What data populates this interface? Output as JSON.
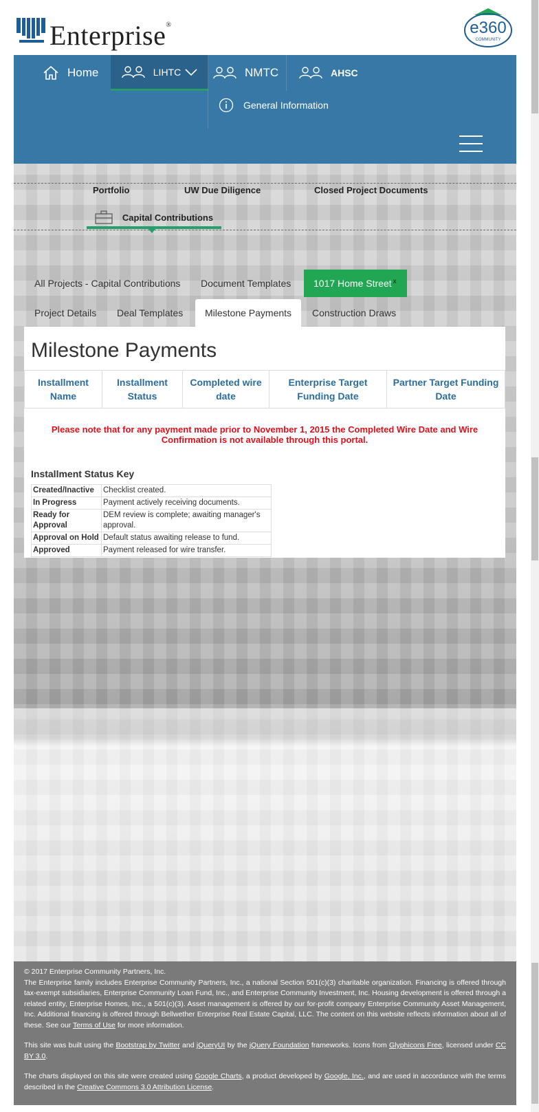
{
  "brand": {
    "name": "Enterprise",
    "reg": "®",
    "badge": "e360",
    "badge_sub": "COMMUNITY"
  },
  "nav": {
    "home": "Home",
    "lihtc": "LIHTC",
    "nmtc": "NMTC",
    "ahsc": "AHSC",
    "general_info": "General Information"
  },
  "subnav": {
    "portfolio": "Portfolio",
    "uw_due_diligence": "UW Due Diligence",
    "closed_docs": "Closed Project Documents",
    "capital_contributions": "Capital Contributions"
  },
  "tabs_row1": [
    "All Projects - Capital Contributions",
    "Document Templates",
    "1017 Home Street"
  ],
  "tab_close": "x",
  "tabs_row2": [
    "Project Details",
    "Deal Templates",
    "Milestone Payments",
    "Construction Draws"
  ],
  "main": {
    "title": "Milestone Payments",
    "columns": [
      "Installment Name",
      "Installment Status",
      "Completed wire date",
      "Enterprise Target Funding Date",
      "Partner Target Funding Date"
    ],
    "note": "Please note that for any payment made prior to November 1, 2015 the Completed Wire Date and Wire Confirmation is not available through this portal.",
    "key_title": "Installment Status Key",
    "key_rows": [
      {
        "status": "Created/Inactive",
        "desc": "Checklist created."
      },
      {
        "status": "In Progress",
        "desc": "Payment actively receiving documents."
      },
      {
        "status": "Ready for Approval",
        "desc": "DEM review is complete; awaiting manager's approval."
      },
      {
        "status": "Approval on Hold",
        "desc": "Default status awaiting release to fund."
      },
      {
        "status": "Approved",
        "desc": "Payment released for wire transfer."
      }
    ]
  },
  "footer": {
    "copyright": "© 2017 Enterprise Community Partners, Inc.",
    "p1": "The Enterprise family includes Enterprise Community Partners, Inc., a national Section 501(c)(3) charitable organization. Financing is offered through tax-exempt subsidiaries, Enterprise Community Loan Fund, Inc., and Enterprise Community Investment, Inc. Housing development is offered through a related entity, Enterprise Homes, Inc., a 501(c)(3). Asset management is offered by our for-profit company Enterprise Community Asset Management, Inc. Additional financing is offered through Bellwether Enterprise Real Estate Capital, LLC. The content on this website reflects information about all of these. See our",
    "terms_link": "Terms of Use",
    "p1_end": "for more information.",
    "p2_a": "This site was built using the",
    "bootstrap_link": "Bootstrap by Twitter",
    "p2_and": "and",
    "jqueryui_link": "jQueryUI",
    "p2_by": "by the",
    "jqf_link": "jQuery Foundation",
    "p2_icons": "frameworks. Icons from",
    "glyph_link": "Glyphicons Free",
    "p2_lic": ", licensed under",
    "cc_link": "CC BY 3.0",
    "p3_a": "The charts displayed on this site were created using",
    "gcharts_link": "Google Charts",
    "p3_b": ", a product developed by",
    "google_link": "Google, Inc.",
    "p3_c": ", and are used in accordance with the terms described in the",
    "cc3_link": "Creative Commons 3.0 Attribution License",
    "p3_end": "."
  },
  "colors": {
    "nav_blue": "#3778a6",
    "accent_green": "#21a654",
    "note_red": "#e0111b",
    "header_blue": "#2b6e9e"
  }
}
